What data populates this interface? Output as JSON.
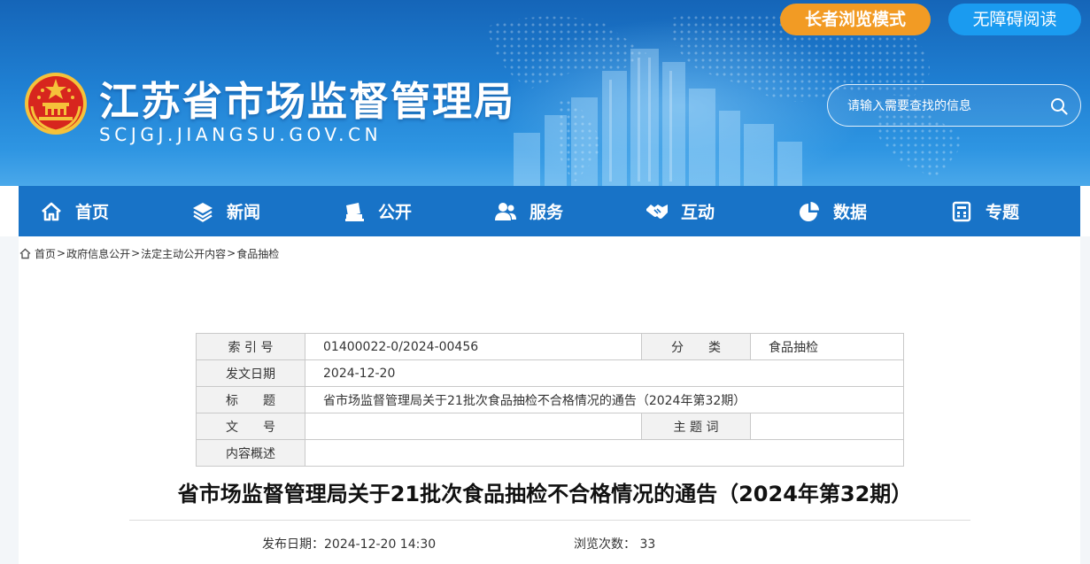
{
  "header": {
    "site_title": "江苏省市场监督管理局",
    "site_domain": "SCJGJ.JIANGSU.GOV.CN",
    "elder_mode_label": "长者浏览模式",
    "accessible_label": "无障碍阅读",
    "search_placeholder": "请输入需要查找的信息"
  },
  "nav": {
    "items": [
      {
        "label": "首页",
        "icon": "home-icon"
      },
      {
        "label": "新闻",
        "icon": "layers-icon"
      },
      {
        "label": "公开",
        "icon": "documents-icon"
      },
      {
        "label": "服务",
        "icon": "users-icon"
      },
      {
        "label": "互动",
        "icon": "handshake-icon"
      },
      {
        "label": "数据",
        "icon": "pie-chart-icon"
      },
      {
        "label": "专题",
        "icon": "calculator-icon"
      }
    ]
  },
  "breadcrumb": {
    "items": [
      "首页",
      "政府信息公开",
      "法定主动公开内容",
      "食品抽检"
    ],
    "separator": ">"
  },
  "meta": {
    "index_label": "索 引 号",
    "index_value": "01400022-0/2024-00456",
    "category_label": "分　　类",
    "category_value": "食品抽检",
    "date_label": "发文日期",
    "date_value": "2024-12-20",
    "title_label": "标　　题",
    "title_value": "省市场监督管理局关于21批次食品抽检不合格情况的通告（2024年第32期）",
    "docno_label": "文　　号",
    "docno_value": "",
    "subject_label": "主 题 词",
    "subject_value": "",
    "summary_label": "内容概述",
    "summary_value": ""
  },
  "article": {
    "title": "省市场监督管理局关于21批次食品抽检不合格情况的通告（2024年第32期）",
    "publish_label": "发布日期：",
    "publish_value": "2024-12-20 14:30",
    "views_label": "浏览次数：",
    "views_value": "33"
  },
  "colors": {
    "header_blue": "#1f7fd2",
    "nav_blue": "#1873c7",
    "elder_orange": "#f29b24",
    "accessible_blue": "#1a9bf0"
  }
}
